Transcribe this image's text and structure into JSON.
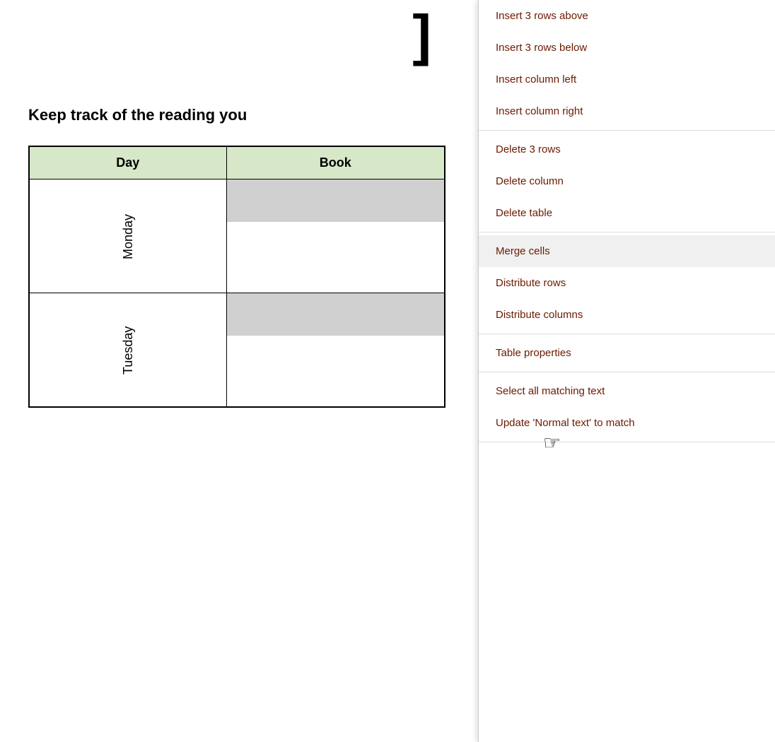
{
  "document": {
    "bracket": "]",
    "title": "Keep track of the reading you",
    "table": {
      "headers": [
        "Day",
        "Book"
      ],
      "rows": [
        {
          "day": "Monday"
        },
        {
          "day": "Tuesday"
        }
      ]
    }
  },
  "context_menu": {
    "items": [
      {
        "id": "insert-rows-above",
        "label": "Insert 3 rows above",
        "group": 1
      },
      {
        "id": "insert-rows-below",
        "label": "Insert 3 rows below",
        "group": 1
      },
      {
        "id": "insert-col-left",
        "label": "Insert column left",
        "group": 1
      },
      {
        "id": "insert-col-right",
        "label": "Insert column right",
        "group": 1
      },
      {
        "id": "delete-3-rows",
        "label": "Delete 3 rows",
        "group": 2
      },
      {
        "id": "delete-column",
        "label": "Delete column",
        "group": 2
      },
      {
        "id": "delete-table",
        "label": "Delete table",
        "group": 2
      },
      {
        "id": "merge-cells",
        "label": "Merge cells",
        "group": 3,
        "hovered": true
      },
      {
        "id": "distribute-rows",
        "label": "Distribute rows",
        "group": 3
      },
      {
        "id": "distribute-columns",
        "label": "Distribute columns",
        "group": 3
      },
      {
        "id": "table-properties",
        "label": "Table properties",
        "group": 4
      },
      {
        "id": "select-all-matching",
        "label": "Select all matching text",
        "group": 5
      },
      {
        "id": "update-normal-text",
        "label": "Update 'Normal text' to match",
        "group": 5
      }
    ]
  }
}
